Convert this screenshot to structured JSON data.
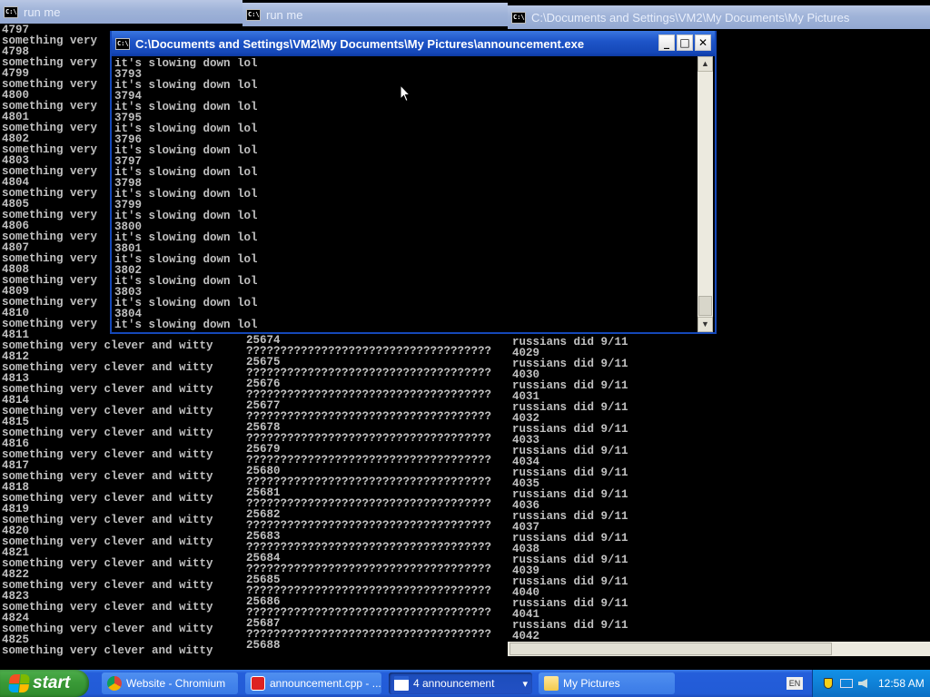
{
  "windows": {
    "run_me": {
      "title": "run me",
      "lines": [
        "4797",
        "something very",
        "4798",
        "something very",
        "4799",
        "something very",
        "4800",
        "something very",
        "4801",
        "something very",
        "4802",
        "something very",
        "4803",
        "something very",
        "4804",
        "something very",
        "4805",
        "something very",
        "4806",
        "something very",
        "4807",
        "something very",
        "4808",
        "something very",
        "4809",
        "something very",
        "4810",
        "something very",
        "4811",
        "something very clever and witty",
        "4812",
        "something very clever and witty",
        "4813",
        "something very clever and witty",
        "4814",
        "something very clever and witty",
        "4815",
        "something very clever and witty",
        "4816",
        "something very clever and witty",
        "4817",
        "something very clever and witty",
        "4818",
        "something very clever and witty",
        "4819",
        "something very clever and witty",
        "4820",
        "something very clever and witty",
        "4821",
        "something very clever and witty",
        "4822",
        "something very clever and witty",
        "4823",
        "something very clever and witty",
        "4824",
        "something very clever and witty",
        "4825",
        "something very clever and witty"
      ]
    },
    "run_me_2": {
      "title": "run me",
      "lines": [
        "25674",
        "????????????????????????????????????",
        "25675",
        "????????????????????????????????????",
        "25676",
        "????????????????????????????????????",
        "25677",
        "????????????????????????????????????",
        "25678",
        "????????????????????????????????????",
        "25679",
        "????????????????????????????????????",
        "25680",
        "????????????????????????????????????",
        "25681",
        "????????????????????????????????????",
        "25682",
        "????????????????????????????????????",
        "25683",
        "????????????????????????????????????",
        "25684",
        "????????????????????????????????????",
        "25685",
        "????????????????????????????????????",
        "25686",
        "????????????????????????????????????",
        "25687",
        "????????????????????????????????????",
        "25688"
      ]
    },
    "documents": {
      "title": "C:\\Documents and Settings\\VM2\\My Documents\\My Pictures",
      "lines": [
        "russians did 9/11",
        "4029",
        "russians did 9/11",
        "4030",
        "russians did 9/11",
        "4031",
        "russians did 9/11",
        "4032",
        "russians did 9/11",
        "4033",
        "russians did 9/11",
        "4034",
        "russians did 9/11",
        "4035",
        "russians did 9/11",
        "4036",
        "russians did 9/11",
        "4037",
        "russians did 9/11",
        "4038",
        "russians did 9/11",
        "4039",
        "russians did 9/11",
        "4040",
        "russians did 9/11",
        "4041",
        "russians did 9/11",
        "4042"
      ]
    },
    "announcement": {
      "title": "C:\\Documents and Settings\\VM2\\My Documents\\My Pictures\\announcement.exe",
      "lines": [
        "it's slowing down lol",
        "3793",
        "it's slowing down lol",
        "3794",
        "it's slowing down lol",
        "3795",
        "it's slowing down lol",
        "3796",
        "it's slowing down lol",
        "3797",
        "it's slowing down lol",
        "3798",
        "it's slowing down lol",
        "3799",
        "it's slowing down lol",
        "3800",
        "it's slowing down lol",
        "3801",
        "it's slowing down lol",
        "3802",
        "it's slowing down lol",
        "3803",
        "it's slowing down lol",
        "3804",
        "it's slowing down lol"
      ]
    }
  },
  "icons": {
    "console": "C:\\",
    "minimize": "_",
    "maximize": "□",
    "close": "✕",
    "scroll_up": "▲",
    "scroll_down": "▼"
  },
  "taskbar": {
    "start_label": "start",
    "tasks": [
      {
        "label": "Website - Chromium",
        "icon": "chromium-icon"
      },
      {
        "label": "announcement.cpp - ...",
        "icon": "devcpp-icon"
      },
      {
        "label": "4 announcement",
        "icon": "console-group-icon",
        "arrow": "▾"
      },
      {
        "label": "My Pictures",
        "icon": "folder-icon"
      }
    ],
    "language": "EN",
    "clock": "12:58 AM"
  },
  "colors": {
    "console_text": "#c0c0c0",
    "console_bg": "#000000",
    "title_active": "#1e55c8",
    "title_inactive": "#a3b5d8",
    "taskbar": "#245edb",
    "start": "#3a9a37",
    "tray": "#0f82d8"
  }
}
